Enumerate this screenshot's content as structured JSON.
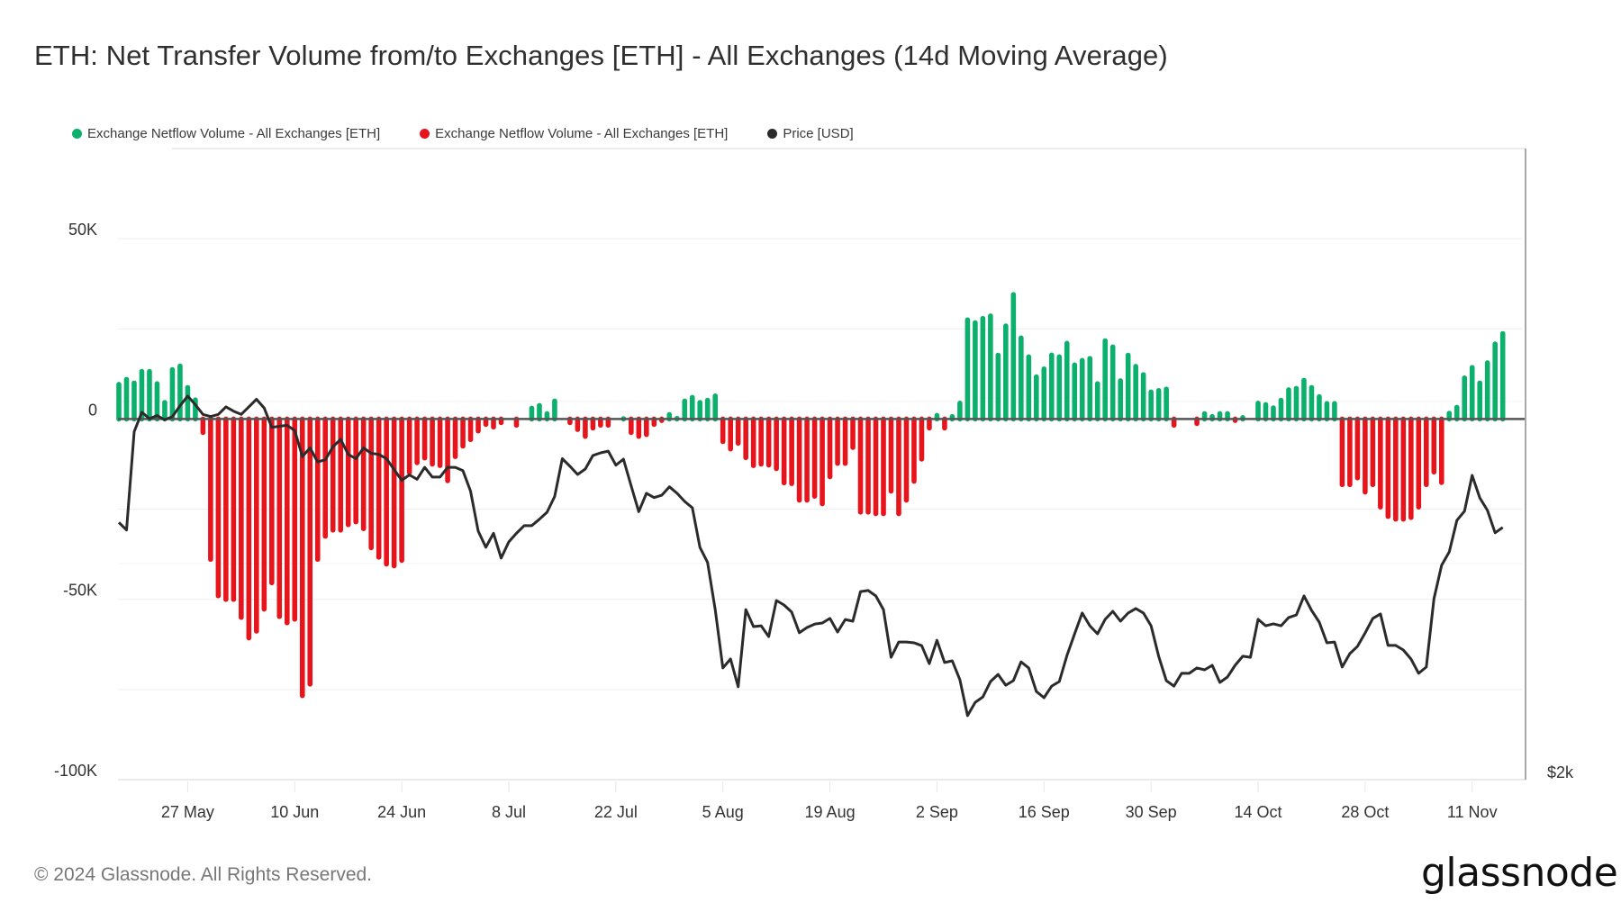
{
  "title": "ETH: Net Transfer Volume from/to Exchanges [ETH] - All Exchanges (14d Moving Average)",
  "legend": [
    {
      "label": "Exchange Netflow Volume - All Exchanges [ETH]",
      "color": "#0bb06d"
    },
    {
      "label": "Exchange Netflow Volume - All Exchanges [ETH]",
      "color": "#e8141c"
    },
    {
      "label": "Price [USD]",
      "color": "#2b2b2b"
    }
  ],
  "footer": "© 2024 Glassnode. All Rights Reserved.",
  "logo": "glassnode",
  "chart_data": {
    "type": "bar",
    "title": "ETH: Net Transfer Volume from/to Exchanges [ETH] - All Exchanges (14d Moving Average)",
    "xlabel": "",
    "ylabel": "",
    "start_date": "2024-05-18",
    "end_date": "2024-11-16",
    "x_ticks": [
      "27 May",
      "10 Jun",
      "24 Jun",
      "8 Jul",
      "22 Jul",
      "5 Aug",
      "19 Aug",
      "2 Sep",
      "16 Sep",
      "30 Sep",
      "14 Oct",
      "28 Oct",
      "11 Nov"
    ],
    "x_tick_day_index": [
      9,
      23,
      37,
      51,
      65,
      79,
      93,
      107,
      121,
      135,
      149,
      163,
      177
    ],
    "y_ticks": [
      {
        "value": 50000,
        "label": "50K"
      },
      {
        "value": 0,
        "label": "0"
      },
      {
        "value": -50000,
        "label": "-50K"
      },
      {
        "value": -100000,
        "label": "-100K"
      }
    ],
    "ylim": [
      -100000,
      75000
    ],
    "y2_ticks": [
      {
        "value": 2000,
        "label": "$2k"
      }
    ],
    "y2lim": [
      2000,
      4920
    ],
    "grid": true,
    "legend_position": "top-left",
    "colors": {
      "positive": "#0bb06d",
      "negative": "#e8141c",
      "price": "#2b2b2b"
    },
    "series": [
      {
        "name": "Exchange Netflow Volume - All Exchanges [ETH]",
        "axis": "left",
        "type": "bar",
        "values": [
          9600,
          11000,
          10000,
          13200,
          13200,
          9800,
          4600,
          13700,
          14700,
          8750,
          5300,
          -3750,
          -38900,
          -49000,
          -50000,
          -50000,
          -55000,
          -60700,
          -58800,
          -52700,
          -45400,
          -54750,
          -56500,
          -55500,
          -76700,
          -73500,
          -38900,
          -32500,
          -30800,
          -30800,
          -29300,
          -28500,
          -30400,
          -35700,
          -38300,
          -40200,
          -40700,
          -39200,
          -14800,
          -12100,
          -10800,
          -12500,
          -12900,
          -17100,
          -10400,
          -7500,
          -5700,
          -3300,
          -1500,
          -2200,
          -1000,
          0,
          -1700,
          0,
          3000,
          3750,
          1500,
          5000,
          0,
          -1000,
          -2900,
          -4800,
          -2500,
          -1700,
          -1700,
          0,
          100,
          -3750,
          -4800,
          -4300,
          -1500,
          -400,
          1250,
          200,
          5000,
          6000,
          4600,
          5200,
          6400,
          -6250,
          -8300,
          -6700,
          -10700,
          -12900,
          -12500,
          -12750,
          -13750,
          -17700,
          -17900,
          -22500,
          -22500,
          -21400,
          -23500,
          -16000,
          -12300,
          -12300,
          -7900,
          -25800,
          -25800,
          -26250,
          -26250,
          -20000,
          -26250,
          -22500,
          -17250,
          -11100,
          -2500,
          1000,
          -2500,
          700,
          4400,
          27500,
          26700,
          27900,
          28600,
          17700,
          25800,
          34500,
          22500,
          17250,
          11700,
          13900,
          17750,
          17250,
          21000,
          15000,
          16250,
          16800,
          9800,
          21700,
          20000,
          10600,
          17700,
          14600,
          12300,
          7500,
          7900,
          8300,
          -1700,
          0,
          0,
          -1250,
          1500,
          700,
          1500,
          1500,
          -400,
          400,
          0,
          4400,
          4000,
          3100,
          5200,
          8100,
          8500,
          10750,
          8750,
          6200,
          4300,
          4300,
          -18200,
          -18200,
          -16300,
          -20250,
          -18200,
          -24400,
          -27000,
          -27750,
          -27750,
          -27300,
          -24400,
          -18200,
          -14700,
          -17600,
          1600,
          3250,
          11400,
          14300,
          10000,
          15600,
          20800,
          23700
        ]
      },
      {
        "name": "Price [USD]",
        "axis": "right",
        "type": "line",
        "values": [
          3190,
          3155,
          3610,
          3700,
          3670,
          3685,
          3665,
          3680,
          3730,
          3775,
          3735,
          3690,
          3680,
          3690,
          3725,
          3705,
          3690,
          3725,
          3760,
          3720,
          3630,
          3635,
          3640,
          3615,
          3495,
          3535,
          3470,
          3480,
          3540,
          3575,
          3505,
          3485,
          3535,
          3510,
          3505,
          3485,
          3435,
          3385,
          3410,
          3390,
          3445,
          3400,
          3400,
          3445,
          3445,
          3430,
          3335,
          3150,
          3075,
          3140,
          3025,
          3100,
          3140,
          3175,
          3175,
          3205,
          3237,
          3310,
          3485,
          3450,
          3412,
          3437,
          3500,
          3512,
          3520,
          3455,
          3483,
          3360,
          3240,
          3325,
          3305,
          3316,
          3355,
          3325,
          3287,
          3258,
          3075,
          3005,
          2787,
          2517,
          2558,
          2430,
          2787,
          2708,
          2712,
          2662,
          2829,
          2808,
          2775,
          2680,
          2704,
          2720,
          2725,
          2746,
          2683,
          2741,
          2733,
          2870,
          2875,
          2850,
          2787,
          2566,
          2637,
          2637,
          2633,
          2620,
          2537,
          2645,
          2542,
          2550,
          2462,
          2296,
          2358,
          2383,
          2454,
          2487,
          2437,
          2458,
          2545,
          2517,
          2408,
          2379,
          2433,
          2454,
          2575,
          2675,
          2771,
          2712,
          2675,
          2742,
          2779,
          2733,
          2771,
          2792,
          2771,
          2712,
          2571,
          2458,
          2433,
          2492,
          2492,
          2517,
          2508,
          2529,
          2450,
          2475,
          2529,
          2571,
          2566,
          2742,
          2712,
          2721,
          2712,
          2750,
          2762,
          2850,
          2783,
          2729,
          2633,
          2637,
          2521,
          2583,
          2617,
          2679,
          2746,
          2767,
          2621,
          2621,
          2600,
          2558,
          2492,
          2521,
          2837,
          2992,
          3054,
          3200,
          3242,
          3408,
          3304,
          3246,
          3142,
          3167
        ]
      }
    ]
  }
}
